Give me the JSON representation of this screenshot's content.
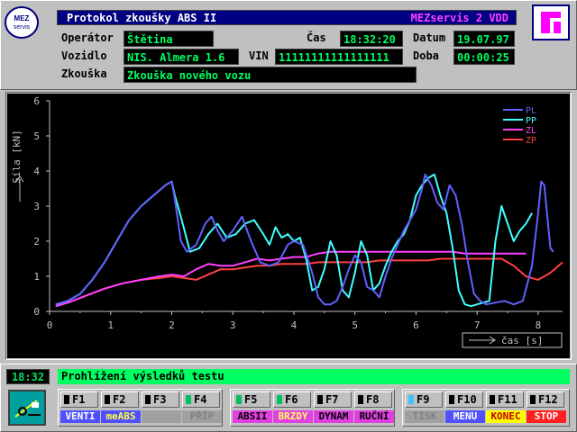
{
  "header": {
    "title": "Protokol zkoušky ABS II",
    "company": "MEZservis 2 VDD",
    "logo_text": [
      "MEZ",
      "servis"
    ],
    "right_logo": "Fr"
  },
  "info": {
    "operator_label": "Operátor",
    "operator_value": "Štětina",
    "vehicle_label": "Vozidlo",
    "vehicle_value": "NIS. Almera 1.6",
    "vin_label": "VIN",
    "vin_value": "11111111111111111",
    "test_label": "Zkouška",
    "test_value": "Zkouška nového vozu",
    "time_label": "Čas",
    "time_value": "18:32:20",
    "date_label": "Datum",
    "date_value": "19.07.97",
    "duration_label": "Doba",
    "duration_value": "00:00:25"
  },
  "status": {
    "clock": "18:32",
    "message": "Prohlížení výsledků testu"
  },
  "fkeys": [
    {
      "key": "F1",
      "label": "VENTI",
      "led": false,
      "label_bg": "#5050ff",
      "label_fg": "#ffffff"
    },
    {
      "key": "F2",
      "label": "meABS",
      "led": false,
      "label_bg": "#5050ff",
      "label_fg": "#ffff40"
    },
    {
      "key": "F3",
      "label": "",
      "led": false,
      "label_bg": "#a0a0a0",
      "label_fg": "#808080"
    },
    {
      "key": "F4",
      "label": "PŘÍP",
      "led": true,
      "label_bg": "#a0a0a0",
      "label_fg": "#808080"
    },
    {
      "key": "F5",
      "label": "ABSII",
      "led": true,
      "label_bg": "#e040e0",
      "label_fg": "#000000"
    },
    {
      "key": "F6",
      "label": "BRZDY",
      "led": true,
      "label_bg": "#e040e0",
      "label_fg": "#ffff60"
    },
    {
      "key": "F7",
      "label": "DYNAM",
      "led": false,
      "label_bg": "#e040e0",
      "label_fg": "#000000"
    },
    {
      "key": "F8",
      "label": "RUČNÍ",
      "led": false,
      "label_bg": "#e040e0",
      "label_fg": "#000000"
    },
    {
      "key": "F9",
      "label": "TISK",
      "led": true,
      "led_color": "#40c0ff",
      "label_bg": "#a0a0a0",
      "label_fg": "#808080"
    },
    {
      "key": "F10",
      "label": "MENU",
      "led": false,
      "label_bg": "#5050ff",
      "label_fg": "#ffffff"
    },
    {
      "key": "F11",
      "label": "KONEC",
      "led": false,
      "label_bg": "#ffff00",
      "label_fg": "#c00000"
    },
    {
      "key": "F12",
      "label": "STOP",
      "led": false,
      "label_bg": "#ff2020",
      "label_fg": "#ffffff"
    }
  ],
  "chart_data": {
    "type": "line",
    "ylabel": "Síla [kN]",
    "xlabel": "čas [s]",
    "xlim": [
      0,
      8.4
    ],
    "ylim": [
      0,
      6
    ],
    "xticks": [
      0,
      1,
      2,
      3,
      4,
      5,
      6,
      7,
      8
    ],
    "yticks": [
      0,
      1,
      2,
      3,
      4,
      5,
      6
    ],
    "legend_position": "top-right",
    "series": [
      {
        "name": "PL",
        "color": "#6060ff",
        "x": [
          0.1,
          0.2,
          0.3,
          0.5,
          0.7,
          0.9,
          1.1,
          1.3,
          1.5,
          1.7,
          1.9,
          2.0,
          2.05,
          2.15,
          2.25,
          2.4,
          2.55,
          2.65,
          2.75,
          2.85,
          3.0,
          3.15,
          3.3,
          3.45,
          3.6,
          3.75,
          3.9,
          4.0,
          4.15,
          4.3,
          4.4,
          4.5,
          4.6,
          4.7,
          4.8,
          4.9,
          5.0,
          5.1,
          5.2,
          5.3,
          5.4,
          5.5,
          5.6,
          5.7,
          5.8,
          5.9,
          6.0,
          6.1,
          6.15,
          6.25,
          6.35,
          6.45,
          6.55,
          6.65,
          6.75,
          6.85,
          6.95,
          7.05,
          7.15,
          7.3,
          7.45,
          7.6,
          7.75,
          7.9,
          8.0,
          8.05,
          8.1,
          8.2,
          8.25
        ],
        "y": [
          0.2,
          0.25,
          0.3,
          0.5,
          0.9,
          1.4,
          2.0,
          2.6,
          3.0,
          3.3,
          3.6,
          3.7,
          3.2,
          2.0,
          1.7,
          1.9,
          2.5,
          2.7,
          2.3,
          2.0,
          2.3,
          2.7,
          2.0,
          1.4,
          1.3,
          1.4,
          1.9,
          2.0,
          1.9,
          1.1,
          0.4,
          0.2,
          0.2,
          0.3,
          0.7,
          1.2,
          1.6,
          1.4,
          0.7,
          0.6,
          0.4,
          1.0,
          1.5,
          1.9,
          2.3,
          2.6,
          2.9,
          3.5,
          3.9,
          3.6,
          3.1,
          2.9,
          3.6,
          3.3,
          2.5,
          1.4,
          0.5,
          0.3,
          0.2,
          0.25,
          0.3,
          0.2,
          0.3,
          1.3,
          2.8,
          3.7,
          3.6,
          1.8,
          1.7
        ]
      },
      {
        "name": "PP",
        "color": "#40ffff",
        "x": [
          0.1,
          0.2,
          0.3,
          0.5,
          0.7,
          0.9,
          1.1,
          1.3,
          1.5,
          1.7,
          1.9,
          2.0,
          2.05,
          2.15,
          2.3,
          2.45,
          2.6,
          2.75,
          2.9,
          3.05,
          3.2,
          3.35,
          3.5,
          3.6,
          3.7,
          3.8,
          3.9,
          4.0,
          4.1,
          4.2,
          4.3,
          4.4,
          4.5,
          4.6,
          4.7,
          4.8,
          4.9,
          5.0,
          5.1,
          5.2,
          5.3,
          5.4,
          5.5,
          5.6,
          5.7,
          5.8,
          5.9,
          6.0,
          6.1,
          6.2,
          6.3,
          6.4,
          6.5,
          6.6,
          6.7,
          6.8,
          6.9,
          7.0,
          7.1,
          7.2,
          7.3,
          7.4,
          7.5,
          7.6,
          7.7,
          7.8,
          7.9
        ],
        "y": [
          0.2,
          0.25,
          0.3,
          0.5,
          0.9,
          1.4,
          2.0,
          2.6,
          3.0,
          3.3,
          3.6,
          3.7,
          3.3,
          2.7,
          1.7,
          1.8,
          2.2,
          2.5,
          2.1,
          2.2,
          2.5,
          2.6,
          2.2,
          1.9,
          2.4,
          2.1,
          2.2,
          2.0,
          2.1,
          1.5,
          0.6,
          0.7,
          1.2,
          2.0,
          1.6,
          0.6,
          0.4,
          1.1,
          2.0,
          1.6,
          0.6,
          0.8,
          1.3,
          1.7,
          2.0,
          2.2,
          2.6,
          3.3,
          3.6,
          3.8,
          3.9,
          3.3,
          2.8,
          1.8,
          0.6,
          0.2,
          0.15,
          0.2,
          0.25,
          0.3,
          2.0,
          3.0,
          2.5,
          2.0,
          2.3,
          2.5,
          2.8
        ]
      },
      {
        "name": "ZL",
        "color": "#ff40ff",
        "x": [
          0.1,
          0.3,
          0.6,
          0.9,
          1.2,
          1.5,
          1.8,
          2.0,
          2.2,
          2.4,
          2.6,
          2.8,
          3.0,
          3.2,
          3.4,
          3.6,
          3.8,
          4.0,
          4.2,
          4.4,
          4.6,
          4.8,
          5.0,
          5.2,
          5.4,
          5.6,
          5.8,
          6.0,
          6.2,
          6.4,
          6.6,
          6.8,
          7.0,
          7.2,
          7.4,
          7.6,
          7.8
        ],
        "y": [
          0.15,
          0.25,
          0.45,
          0.65,
          0.8,
          0.9,
          1.0,
          1.05,
          1.0,
          1.2,
          1.35,
          1.3,
          1.3,
          1.4,
          1.5,
          1.45,
          1.5,
          1.55,
          1.55,
          1.65,
          1.7,
          1.7,
          1.7,
          1.7,
          1.7,
          1.7,
          1.7,
          1.7,
          1.7,
          1.7,
          1.7,
          1.65,
          1.65,
          1.65,
          1.65,
          1.65,
          1.65
        ]
      },
      {
        "name": "ZP",
        "color": "#ff4040",
        "x": [
          0.1,
          0.3,
          0.6,
          0.9,
          1.2,
          1.5,
          1.8,
          2.0,
          2.2,
          2.4,
          2.6,
          2.8,
          3.0,
          3.2,
          3.4,
          3.6,
          3.8,
          4.0,
          4.2,
          4.4,
          4.6,
          4.8,
          5.0,
          5.2,
          5.4,
          5.6,
          5.8,
          6.0,
          6.2,
          6.4,
          6.6,
          6.8,
          7.0,
          7.2,
          7.4,
          7.6,
          7.8,
          8.0,
          8.2,
          8.4
        ],
        "y": [
          0.15,
          0.25,
          0.45,
          0.65,
          0.8,
          0.9,
          0.95,
          1.0,
          0.95,
          0.9,
          1.05,
          1.2,
          1.2,
          1.25,
          1.3,
          1.3,
          1.35,
          1.35,
          1.35,
          1.4,
          1.4,
          1.4,
          1.4,
          1.4,
          1.45,
          1.45,
          1.45,
          1.45,
          1.45,
          1.5,
          1.5,
          1.5,
          1.5,
          1.5,
          1.5,
          1.3,
          1.0,
          0.9,
          1.1,
          1.4
        ]
      }
    ]
  }
}
